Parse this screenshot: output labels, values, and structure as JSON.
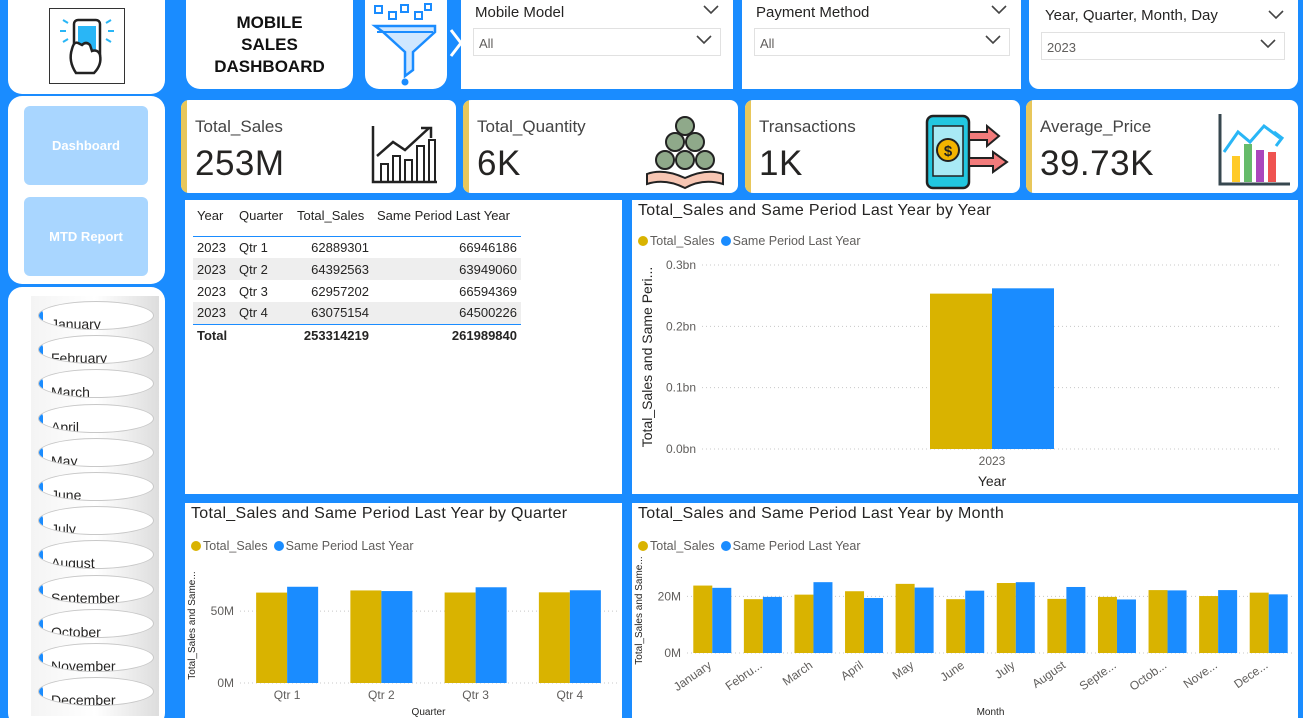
{
  "header": {
    "title": "MOBILE SALES\nDASHBOARD",
    "logo_icon": "phone-hand-icon",
    "filter_icon": "funnel-icon"
  },
  "slicers": {
    "mobile_model": {
      "label": "Mobile Model",
      "value": "All"
    },
    "payment_method": {
      "label": "Payment Method",
      "value": "All"
    },
    "date": {
      "label": "Year, Quarter, Month, Day",
      "value": "2023"
    }
  },
  "nav": {
    "dashboard": "Dashboard",
    "mtd_report": "MTD Report"
  },
  "months": [
    "January",
    "February",
    "March",
    "April",
    "May",
    "June",
    "July",
    "August",
    "September",
    "October",
    "November",
    "December"
  ],
  "kpis": [
    {
      "label": "Total_Sales",
      "value": "253M",
      "icon": "line-chart-icon"
    },
    {
      "label": "Total_Quantity",
      "value": "6K",
      "icon": "coins-hand-icon"
    },
    {
      "label": "Transactions",
      "value": "1K",
      "icon": "phone-payment-icon"
    },
    {
      "label": "Average_Price",
      "value": "39.73K",
      "icon": "bar-chart-icon"
    }
  ],
  "table": {
    "headers": [
      "Year",
      "Quarter",
      "Total_Sales",
      "Same Period Last Year"
    ],
    "rows": [
      [
        "2023",
        "Qtr 1",
        "62889301",
        "66946186"
      ],
      [
        "2023",
        "Qtr 2",
        "64392563",
        "63949060"
      ],
      [
        "2023",
        "Qtr 3",
        "62957202",
        "66594369"
      ],
      [
        "2023",
        "Qtr 4",
        "63075154",
        "64500226"
      ]
    ],
    "total": [
      "Total",
      "253314219",
      "261989840"
    ]
  },
  "colors": {
    "total_sales": "#d9b300",
    "same_period": "#1a8cff",
    "kpi_accent": "#e8c75b"
  },
  "chart_data": [
    {
      "type": "bar",
      "title": "Total_Sales and Same Period Last Year by Year",
      "xlabel": "Year",
      "ylabel": "Total_Sales and Same Peri...",
      "categories": [
        "2023"
      ],
      "series": [
        {
          "name": "Total_Sales",
          "values": [
            253314219
          ]
        },
        {
          "name": "Same Period Last Year",
          "values": [
            261989840
          ]
        }
      ],
      "ylim": [
        0,
        300000000
      ],
      "yticks": [
        "0.0bn",
        "0.1bn",
        "0.2bn",
        "0.3bn"
      ],
      "legend": "top-left"
    },
    {
      "type": "bar",
      "title": "Total_Sales and Same Period Last Year by Quarter",
      "xlabel": "Quarter",
      "ylabel": "Total_Sales and Same...",
      "categories": [
        "Qtr 1",
        "Qtr 2",
        "Qtr 3",
        "Qtr 4"
      ],
      "series": [
        {
          "name": "Total_Sales",
          "values": [
            62889301,
            64392563,
            62957202,
            63075154
          ]
        },
        {
          "name": "Same Period Last Year",
          "values": [
            66946186,
            63949060,
            66594369,
            64500226
          ]
        }
      ],
      "ylim": [
        0,
        80000000
      ],
      "yticks": [
        "0M",
        "50M"
      ],
      "legend": "top-left"
    },
    {
      "type": "bar",
      "title": "Total_Sales and Same Period Last Year by Month",
      "xlabel": "Month",
      "ylabel": "Total_Sales and Same...",
      "categories": [
        "January",
        "Febru...",
        "March",
        "April",
        "May",
        "June",
        "July",
        "August",
        "Septe...",
        "Octob...",
        "Nove...",
        "Dece..."
      ],
      "series": [
        {
          "name": "Total_Sales",
          "values": [
            23800000,
            19000000,
            20600000,
            21800000,
            24400000,
            19000000,
            24700000,
            19100000,
            19800000,
            22200000,
            20100000,
            21300000
          ]
        },
        {
          "name": "Same Period Last Year",
          "values": [
            23000000,
            19800000,
            25000000,
            19400000,
            23100000,
            22000000,
            25000000,
            23300000,
            18900000,
            22100000,
            22200000,
            20700000
          ]
        }
      ],
      "ylim": [
        0,
        30000000
      ],
      "yticks": [
        "0M",
        "20M"
      ],
      "legend": "top-left"
    }
  ]
}
